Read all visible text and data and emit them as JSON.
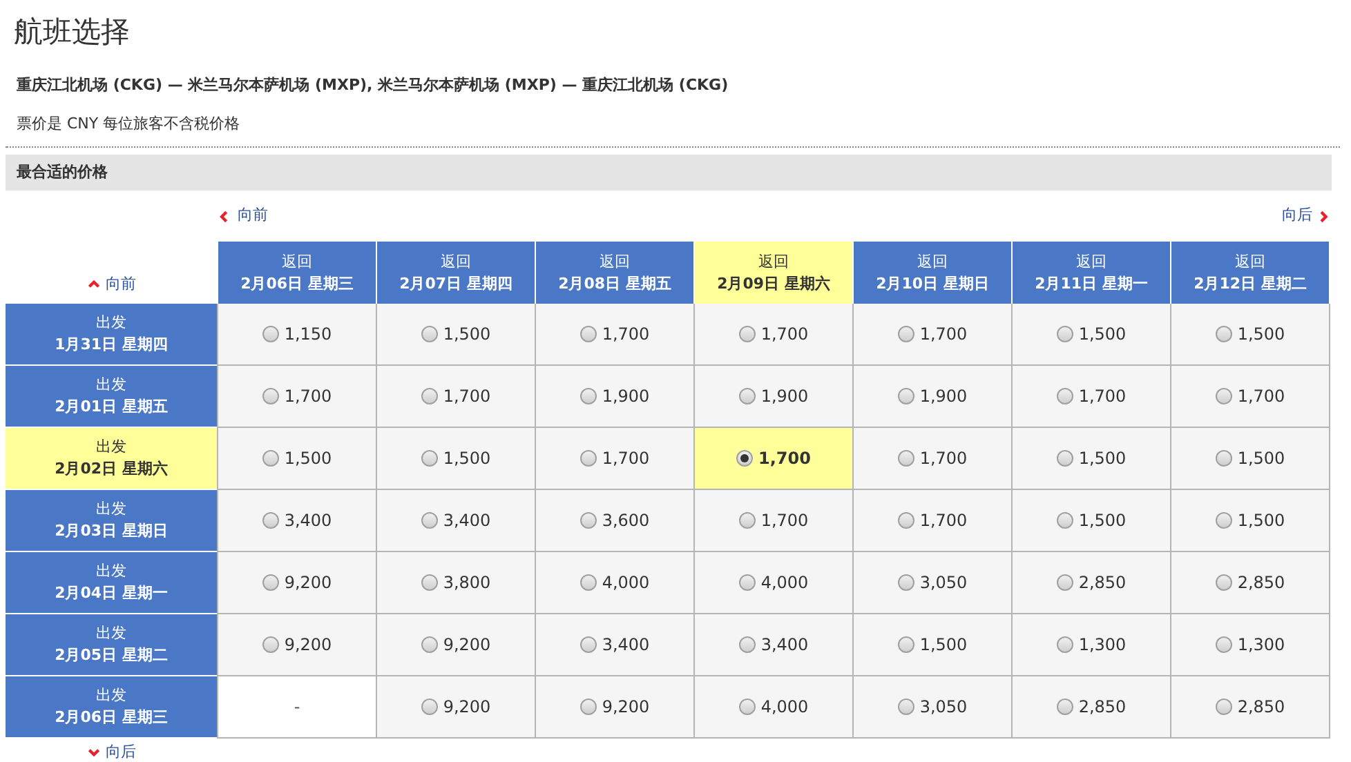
{
  "title": "航班选择",
  "route": "重庆江北机场 (CKG) — 米兰马尔本萨机场 (MXP), 米兰马尔本萨机场 (MXP) — 重庆江北机场 (CKG)",
  "note": "票价是 CNY 每位旅客不含税价格",
  "section_title": "最合适的价格",
  "nav": {
    "earlier_return": "向前",
    "later_return": "向后",
    "earlier_departure": "向前",
    "later_departure": "向后"
  },
  "return_dates": [
    {
      "label": "返回",
      "date": "2月06日 星期三",
      "selected": false
    },
    {
      "label": "返回",
      "date": "2月07日 星期四",
      "selected": false
    },
    {
      "label": "返回",
      "date": "2月08日 星期五",
      "selected": false
    },
    {
      "label": "返回",
      "date": "2月09日 星期六",
      "selected": true
    },
    {
      "label": "返回",
      "date": "2月10日 星期日",
      "selected": false
    },
    {
      "label": "返回",
      "date": "2月11日 星期一",
      "selected": false
    },
    {
      "label": "返回",
      "date": "2月12日 星期二",
      "selected": false
    }
  ],
  "rows": [
    {
      "label": "出发",
      "date": "1月31日 星期四",
      "selected": false,
      "prices": [
        {
          "kind": "fare",
          "price": "1,150",
          "selected": false
        },
        {
          "kind": "fare",
          "price": "1,500",
          "selected": false
        },
        {
          "kind": "fare",
          "price": "1,700",
          "selected": false
        },
        {
          "kind": "fare",
          "price": "1,700",
          "selected": false
        },
        {
          "kind": "fare",
          "price": "1,700",
          "selected": false
        },
        {
          "kind": "fare",
          "price": "1,500",
          "selected": false
        },
        {
          "kind": "fare",
          "price": "1,500",
          "selected": false
        }
      ]
    },
    {
      "label": "出发",
      "date": "2月01日 星期五",
      "selected": false,
      "prices": [
        {
          "kind": "fare",
          "price": "1,700",
          "selected": false
        },
        {
          "kind": "fare",
          "price": "1,700",
          "selected": false
        },
        {
          "kind": "fare",
          "price": "1,900",
          "selected": false
        },
        {
          "kind": "fare",
          "price": "1,900",
          "selected": false
        },
        {
          "kind": "fare",
          "price": "1,900",
          "selected": false
        },
        {
          "kind": "fare",
          "price": "1,700",
          "selected": false
        },
        {
          "kind": "fare",
          "price": "1,700",
          "selected": false
        }
      ]
    },
    {
      "label": "出发",
      "date": "2月02日 星期六",
      "selected": true,
      "prices": [
        {
          "kind": "fare",
          "price": "1,500",
          "selected": false
        },
        {
          "kind": "fare",
          "price": "1,500",
          "selected": false
        },
        {
          "kind": "fare",
          "price": "1,700",
          "selected": false
        },
        {
          "kind": "fare",
          "price": "1,700",
          "selected": true
        },
        {
          "kind": "fare",
          "price": "1,700",
          "selected": false
        },
        {
          "kind": "fare",
          "price": "1,500",
          "selected": false
        },
        {
          "kind": "fare",
          "price": "1,500",
          "selected": false
        }
      ]
    },
    {
      "label": "出发",
      "date": "2月03日 星期日",
      "selected": false,
      "prices": [
        {
          "kind": "fare",
          "price": "3,400",
          "selected": false
        },
        {
          "kind": "fare",
          "price": "3,400",
          "selected": false
        },
        {
          "kind": "fare",
          "price": "3,600",
          "selected": false
        },
        {
          "kind": "fare",
          "price": "1,700",
          "selected": false
        },
        {
          "kind": "fare",
          "price": "1,700",
          "selected": false
        },
        {
          "kind": "fare",
          "price": "1,500",
          "selected": false
        },
        {
          "kind": "fare",
          "price": "1,500",
          "selected": false
        }
      ]
    },
    {
      "label": "出发",
      "date": "2月04日 星期一",
      "selected": false,
      "prices": [
        {
          "kind": "fare",
          "price": "9,200",
          "selected": false
        },
        {
          "kind": "fare",
          "price": "3,800",
          "selected": false
        },
        {
          "kind": "fare",
          "price": "4,000",
          "selected": false
        },
        {
          "kind": "fare",
          "price": "4,000",
          "selected": false
        },
        {
          "kind": "fare",
          "price": "3,050",
          "selected": false
        },
        {
          "kind": "fare",
          "price": "2,850",
          "selected": false
        },
        {
          "kind": "fare",
          "price": "2,850",
          "selected": false
        }
      ]
    },
    {
      "label": "出发",
      "date": "2月05日 星期二",
      "selected": false,
      "prices": [
        {
          "kind": "fare",
          "price": "9,200",
          "selected": false
        },
        {
          "kind": "fare",
          "price": "9,200",
          "selected": false
        },
        {
          "kind": "fare",
          "price": "3,400",
          "selected": false
        },
        {
          "kind": "fare",
          "price": "3,400",
          "selected": false
        },
        {
          "kind": "fare",
          "price": "1,500",
          "selected": false
        },
        {
          "kind": "fare",
          "price": "1,300",
          "selected": false
        },
        {
          "kind": "fare",
          "price": "1,300",
          "selected": false
        }
      ]
    },
    {
      "label": "出发",
      "date": "2月06日 星期三",
      "selected": false,
      "prices": [
        {
          "kind": "unavailable",
          "price": "-"
        },
        {
          "kind": "fare",
          "price": "9,200",
          "selected": false
        },
        {
          "kind": "fare",
          "price": "9,200",
          "selected": false
        },
        {
          "kind": "fare",
          "price": "4,000",
          "selected": false
        },
        {
          "kind": "fare",
          "price": "3,050",
          "selected": false
        },
        {
          "kind": "fare",
          "price": "2,850",
          "selected": false
        },
        {
          "kind": "fare",
          "price": "2,850",
          "selected": false
        }
      ]
    }
  ]
}
